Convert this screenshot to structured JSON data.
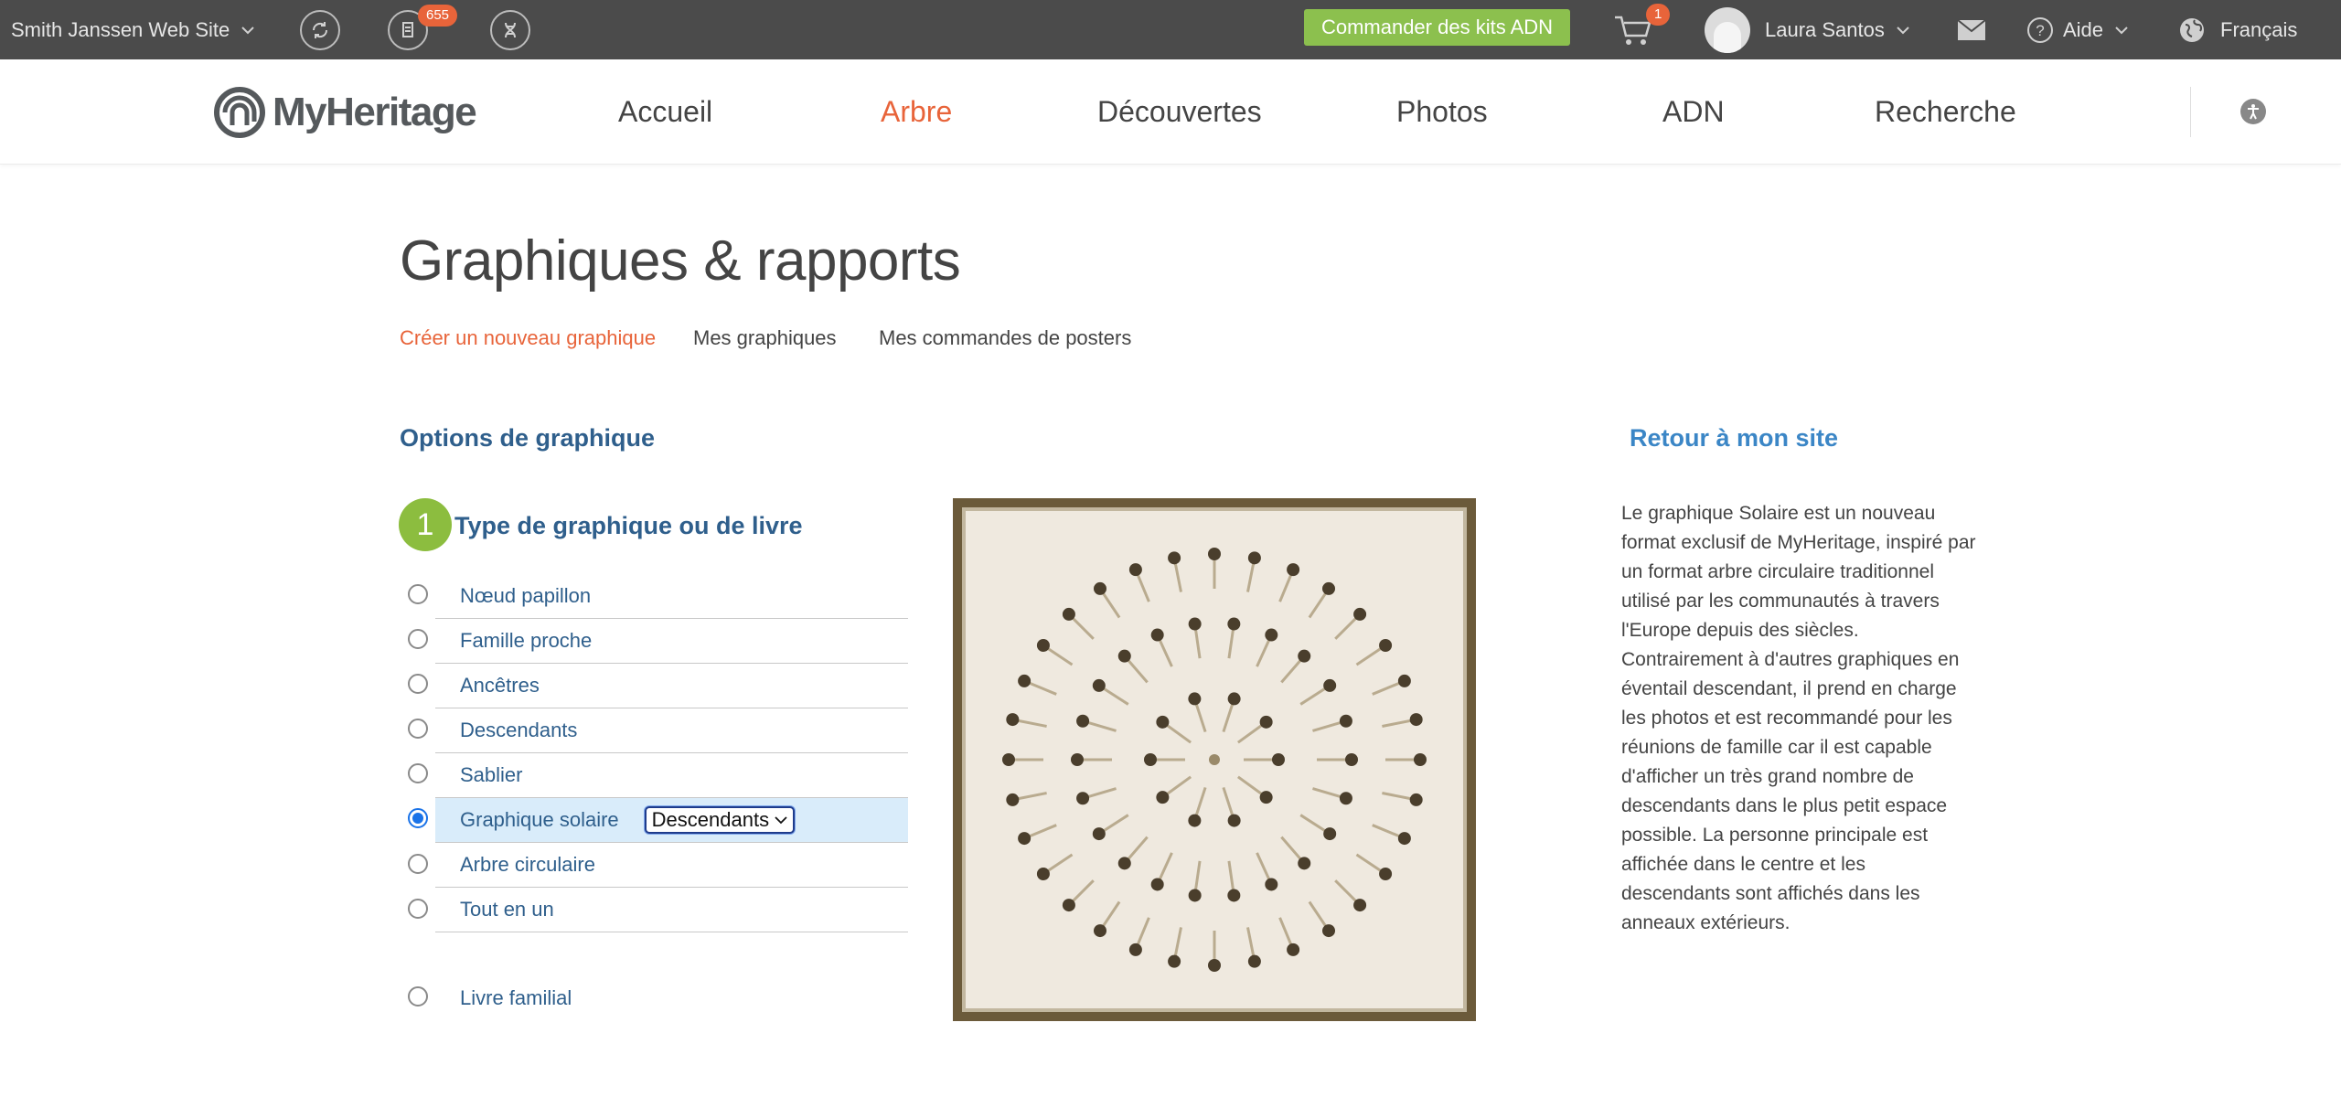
{
  "topbar": {
    "site_name": "Smith Janssen Web Site",
    "notification_count": "655",
    "dna_button": "Commander des kits ADN",
    "cart_count": "1",
    "user_name": "Laura Santos",
    "help_label": "Aide",
    "language": "Français"
  },
  "brand": {
    "logo_text": "MyHeritage"
  },
  "nav": {
    "items": [
      {
        "label": "Accueil"
      },
      {
        "label": "Arbre"
      },
      {
        "label": "Découvertes"
      },
      {
        "label": "Photos"
      },
      {
        "label": "ADN"
      },
      {
        "label": "Recherche"
      }
    ],
    "active": "Arbre"
  },
  "page": {
    "title": "Graphiques & rapports",
    "tabs": [
      {
        "label": "Créer un nouveau graphique"
      },
      {
        "label": "Mes graphiques"
      },
      {
        "label": "Mes commandes de posters"
      }
    ],
    "options_heading": "Options de graphique",
    "step_number": "1",
    "step_title": "Type de graphique ou de livre",
    "chart_types": [
      {
        "label": "Nœud papillon",
        "selected": false
      },
      {
        "label": "Famille proche",
        "selected": false
      },
      {
        "label": "Ancêtres",
        "selected": false
      },
      {
        "label": "Descendants",
        "selected": false
      },
      {
        "label": "Sablier",
        "selected": false
      },
      {
        "label": "Graphique solaire",
        "selected": true
      },
      {
        "label": "Arbre circulaire",
        "selected": false
      },
      {
        "label": "Tout en un",
        "selected": false
      }
    ],
    "solar_select_value": "Descendants",
    "book_option": "Livre familial",
    "back_link": "Retour à mon site",
    "description": "Le graphique Solaire est un nouveau format exclusif de MyHeritage, inspiré par un format arbre circulaire traditionnel utilisé par les communautés à travers l'Europe depuis des siècles. Contrairement à d'autres graphiques en éventail descendant, il prend en charge les photos et est recommandé pour les réunions de famille car il est capable d'afficher un très grand nombre de descendants dans le plus petit espace possible. La personne principale est affichée dans le centre et les descendants sont affichés dans les anneaux extérieurs."
  },
  "colors": {
    "accent_orange": "#e8643a",
    "dna_green": "#8cc04e",
    "heading_blue": "#2f5f8c",
    "link_blue": "#3b86c6",
    "topbar_bg": "#4b4b4b"
  }
}
